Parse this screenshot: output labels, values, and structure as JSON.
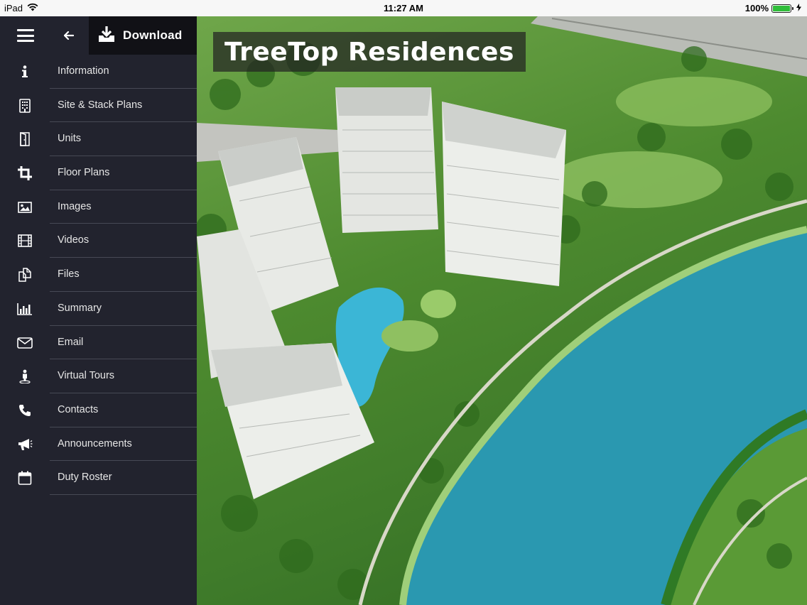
{
  "status_bar": {
    "device": "iPad",
    "time": "11:27 AM",
    "battery": "100%",
    "battery_level": 1.0,
    "icons": [
      "wifi-icon",
      "battery-icon",
      "charging-icon"
    ]
  },
  "header": {
    "menu_icon": "hamburger-icon",
    "back_icon": "back-arrow-icon",
    "download_label": "Download",
    "download_icon": "download-icon"
  },
  "hero": {
    "title": "TreeTop Residences"
  },
  "menu": {
    "items": [
      {
        "label": "Information",
        "icon": "info-icon"
      },
      {
        "label": "Site & Stack Plans",
        "icon": "building-icon"
      },
      {
        "label": "Units",
        "icon": "door-icon"
      },
      {
        "label": "Floor Plans",
        "icon": "crop-icon"
      },
      {
        "label": "Images",
        "icon": "image-icon"
      },
      {
        "label": "Videos",
        "icon": "film-icon"
      },
      {
        "label": "Files",
        "icon": "files-icon"
      },
      {
        "label": "Summary",
        "icon": "bar-chart-icon"
      },
      {
        "label": "Email",
        "icon": "envelope-icon"
      },
      {
        "label": "Virtual Tours",
        "icon": "person-icon"
      },
      {
        "label": "Contacts",
        "icon": "phone-icon"
      },
      {
        "label": "Announcements",
        "icon": "megaphone-icon"
      },
      {
        "label": "Duty Roster",
        "icon": "calendar-icon"
      }
    ]
  },
  "colors": {
    "sidebar": "#22232e",
    "download_bg": "#111116",
    "separator": "#474955",
    "battery": "#2fbe3a"
  }
}
